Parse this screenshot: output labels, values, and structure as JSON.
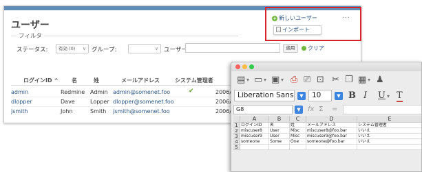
{
  "redmine": {
    "page_title": "ユーザー",
    "filter": {
      "legend": "フィルタ",
      "status_label": "ステータス:",
      "status_value": "有効 (0)",
      "group_label": "グループ:",
      "user_label": "ユーザー:",
      "apply_label": "適用",
      "clear_label": "クリア"
    },
    "actions": {
      "new_user_label": "新しいユーザー",
      "more": "...",
      "import_label": "インポート"
    },
    "table": {
      "headers": [
        "ログインID ^",
        "名",
        "姓",
        "メールアドレス",
        "システム管理者"
      ],
      "rows": [
        {
          "login": "admin",
          "firstname": "Redmine",
          "lastname": "Admin",
          "email": "admin@somenet.foo",
          "admin": true,
          "created": "2006/0"
        },
        {
          "login": "dlopper",
          "firstname": "Dave",
          "lastname": "Lopper",
          "email": "dlopper@somenet.foo",
          "admin": false,
          "created": "2006/0"
        },
        {
          "login": "jsmith",
          "firstname": "John",
          "lastname": "Smith",
          "email": "jsmith@somenet.foo",
          "admin": false,
          "created": "2006/0"
        }
      ]
    }
  },
  "calc": {
    "font_name": "Liberation Sans",
    "font_size": "10",
    "format_buttons": [
      "B",
      "I",
      "U",
      "T"
    ],
    "cell_ref": "G8",
    "fx_symbol": "fx",
    "sum_symbol": "Σ",
    "equals_symbol": "=",
    "columns": [
      "A",
      "B",
      "C",
      "D",
      "E"
    ],
    "rows": [
      {
        "num": "1",
        "cells": [
          "ログインID",
          "名",
          "姓",
          "メールアドレス",
          "システム管理者"
        ]
      },
      {
        "num": "2",
        "cells": [
          "miscuser8",
          "User",
          "Misc",
          "miscuser8@foo.bar",
          "いいえ"
        ]
      },
      {
        "num": "3",
        "cells": [
          "miscuser9",
          "User",
          "Misc",
          "miscuser9@foo.bar",
          "いいえ"
        ]
      },
      {
        "num": "4",
        "cells": [
          "someone",
          "Some",
          "One",
          "someone@foo.bar",
          "いいえ"
        ]
      },
      {
        "num": "5",
        "cells": [
          "",
          "",
          "",
          "",
          ""
        ]
      }
    ],
    "traffic_lights": [
      "#fc605c",
      "#fdbc40",
      "#34c84a"
    ]
  }
}
